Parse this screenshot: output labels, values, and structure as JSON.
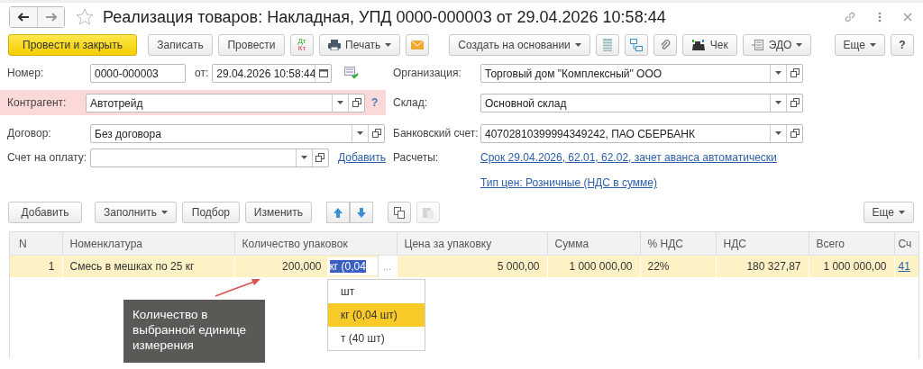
{
  "window": {
    "title": "Реализация товаров: Накладная, УПД 0000-000003 от 29.04.2026 10:58:44"
  },
  "toolbar": {
    "post_close": "Провести и закрыть",
    "save": "Записать",
    "post": "Провести",
    "dt": "Дт",
    "kt": "Кт",
    "print": "Печать",
    "create_based": "Создать на основании",
    "check": "Чек",
    "edo": "ЭДО",
    "more": "Еще",
    "help": "?"
  },
  "form": {
    "number": {
      "label": "Номер:",
      "value": "0000-000003"
    },
    "date": {
      "label": "от:",
      "value": "29.04.2026 10:58:44"
    },
    "contractor": {
      "label": "Контрагент:",
      "value": "Автотрейд",
      "error": true,
      "hint": "?"
    },
    "contract": {
      "label": "Договор:",
      "value": "Без договора"
    },
    "invoice": {
      "label": "Счет на оплату:",
      "link": "Добавить"
    },
    "organization": {
      "label": "Организация:",
      "value": "Торговый дом \"Комплексный\" ООО"
    },
    "warehouse": {
      "label": "Склад:",
      "value": "Основной склад"
    },
    "bank_account": {
      "label": "Банковский счет:",
      "value": "40702810399994349242, ПАО СБЕРБАНК"
    },
    "payments": {
      "label": "Расчеты:",
      "link": "Срок 29.04.2026, 62.01, 62.02, зачет аванса автоматически"
    },
    "price_type": {
      "link": "Тип цен: Розничные (НДС в сумме)"
    }
  },
  "table_toolbar": {
    "add": "Добавить",
    "fill": "Заполнить",
    "pick": "Подбор",
    "edit": "Изменить",
    "paste_disabled": true,
    "more": "Еще"
  },
  "table": {
    "columns": [
      "N",
      "Номенклатура",
      "Количество упаковок",
      "Цена за упаковку",
      "Сумма",
      "% НДС",
      "НДС",
      "Всего",
      "Сч"
    ],
    "rows": [
      {
        "selected": true,
        "n": "1",
        "name": "Смесь в мешках по 25 кг",
        "qty": "200,000",
        "unit": "кг (0,04",
        "unit_button": "...",
        "price": "5 000,00",
        "sum": "1 000 000,00",
        "vat_rate": "22%",
        "vat": "180 327,87",
        "total": "1 000 000,00",
        "account": "41"
      }
    ]
  },
  "unit_dropdown": {
    "options": [
      {
        "label": "шт",
        "selected": false
      },
      {
        "label": "кг (0,04 шт)",
        "selected": true
      },
      {
        "label": "т (40 шт)",
        "selected": false
      }
    ]
  },
  "callout": {
    "text": "Количество в выбранной единице измерения"
  }
}
